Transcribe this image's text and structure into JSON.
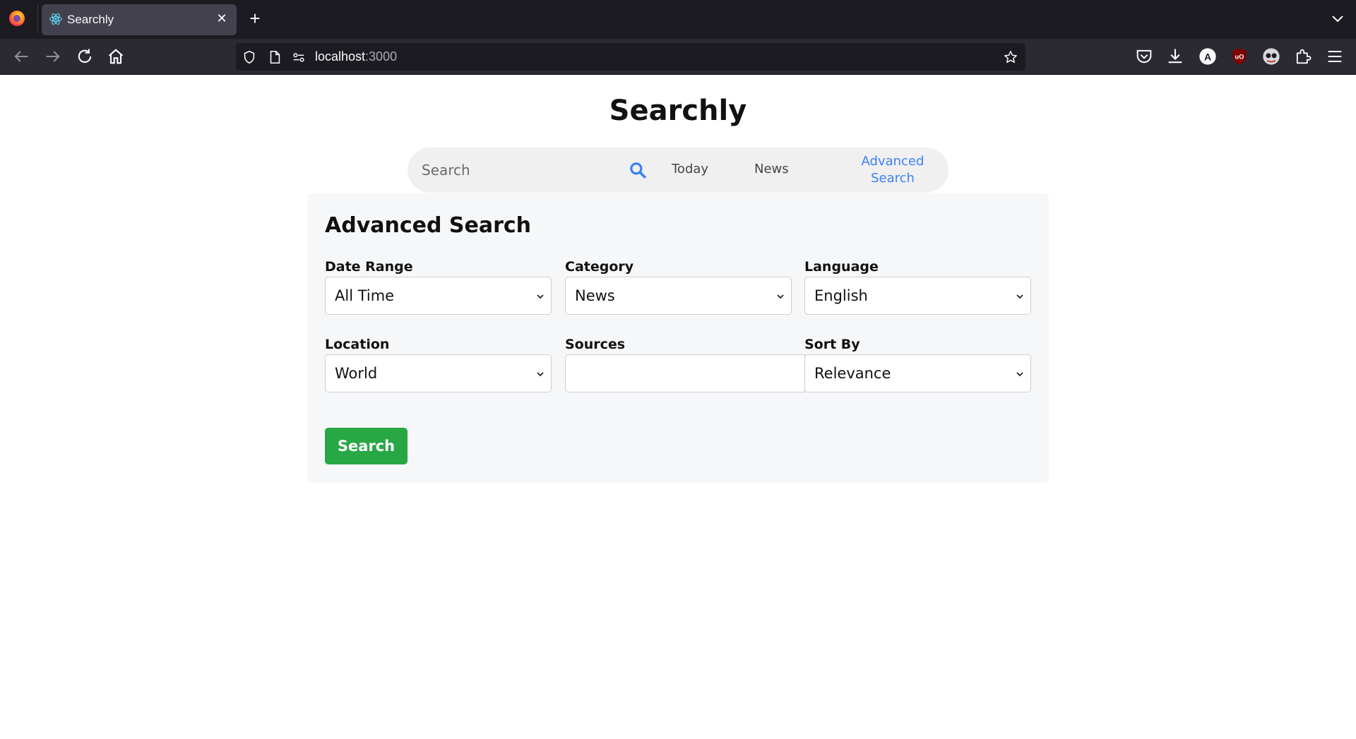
{
  "browser": {
    "tab": {
      "title": "Searchly"
    },
    "url": {
      "host": "localhost",
      "port": ":3000"
    }
  },
  "page": {
    "title": "Searchly",
    "searchbar": {
      "placeholder": "Search",
      "links": {
        "today": "Today",
        "news": "News",
        "advanced_line1": "Advanced",
        "advanced_line2": "Search"
      }
    },
    "advanced": {
      "heading": "Advanced Search",
      "fields": {
        "date_range": {
          "label": "Date Range",
          "value": "All Time"
        },
        "category": {
          "label": "Category",
          "value": "News"
        },
        "language": {
          "label": "Language",
          "value": "English"
        },
        "location": {
          "label": "Location",
          "value": "World"
        },
        "sources": {
          "label": "Sources",
          "value": ""
        },
        "sort_by": {
          "label": "Sort By",
          "value": "Relevance"
        }
      },
      "submit_label": "Search"
    }
  },
  "colors": {
    "accent_blue": "#3b82f6",
    "submit_green": "#28a745"
  }
}
